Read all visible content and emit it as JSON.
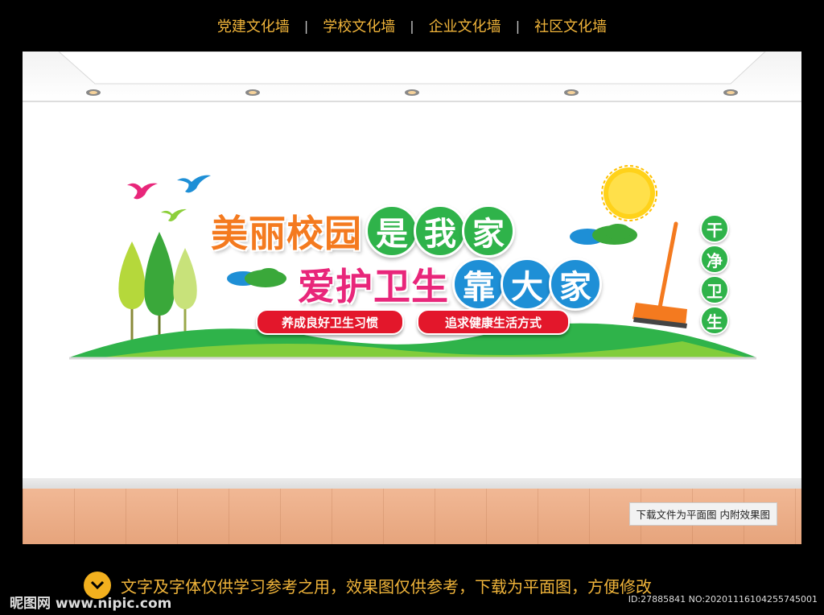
{
  "nav": {
    "items": [
      "党建文化墙",
      "学校文化墙",
      "企业文化墙",
      "社区文化墙"
    ],
    "separator": "|"
  },
  "wall": {
    "title1_plain": "美丽校园",
    "title1_circles": [
      "是",
      "我",
      "家"
    ],
    "title2_plain": "爱护卫生",
    "title2_circles": [
      "靠",
      "大",
      "家"
    ],
    "pill1": "养成良好卫生习惯",
    "pill2": "追求健康生活方式",
    "vertical": [
      "干",
      "净",
      "卫",
      "生"
    ]
  },
  "floor_note": "下载文件为平面图  内附效果图",
  "footer": {
    "icon": "chevron-down-icon",
    "text": "文字及字体仅供学习参考之用，效果图仅供参考，下载为平面图，方便修改"
  },
  "logo": "昵图网 www.nipic.com",
  "image_id": "ID:27885841 NO:20201116104255745001",
  "colors": {
    "nav_text": "#f0b43a",
    "title_orange": "#f47a1f",
    "title_pink": "#e8267a",
    "circle_green": "#2fb34a",
    "circle_blue": "#1e8fd6",
    "pill_red": "#e3172b",
    "sun_yellow": "#ffd21a"
  }
}
